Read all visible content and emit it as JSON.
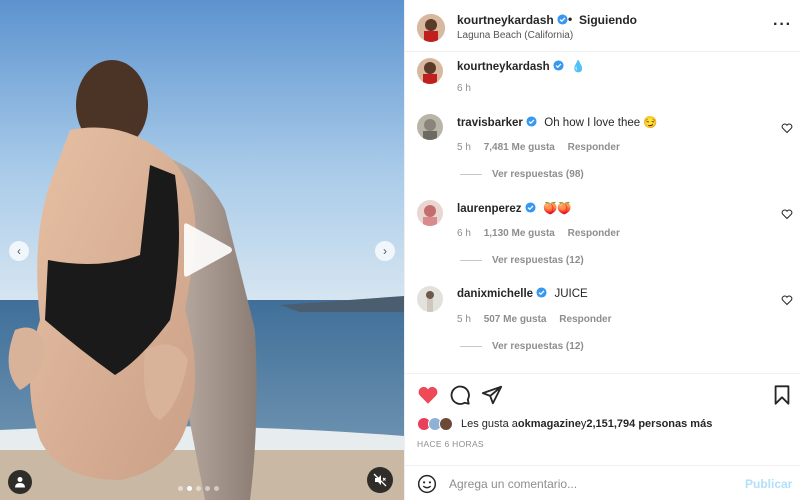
{
  "post": {
    "username": "kourtneykardash",
    "follow_status": "Siguiendo",
    "separator": "•",
    "location": "Laguna Beach (California)",
    "caption_emoji": "💧",
    "caption_time": "6 h"
  },
  "comments": [
    {
      "user": "travisbarker",
      "text": "Oh how I love thee 😏",
      "time": "5 h",
      "likes": "7,481 Me gusta",
      "reply": "Responder",
      "replies": "Ver respuestas (98)"
    },
    {
      "user": "laurenperez",
      "text": "🍑🍑",
      "time": "6 h",
      "likes": "1,130 Me gusta",
      "reply": "Responder",
      "replies": "Ver respuestas (12)"
    },
    {
      "user": "danixmichelle",
      "text": "JUICE",
      "time": "5 h",
      "likes": "507 Me gusta",
      "reply": "Responder",
      "replies": "Ver respuestas (12)"
    }
  ],
  "likes": {
    "prefix": "Les gusta a ",
    "user": "okmagazine",
    "middle": " y ",
    "count": "2,151,794 personas más"
  },
  "timestamp": "HACE 6 HORAS",
  "comment_box": {
    "placeholder": "Agrega un comentario...",
    "post_label": "Publicar"
  },
  "carousel": {
    "count": 5,
    "active_index": 1
  },
  "icons": {
    "verified": "verified-badge-icon",
    "heart_filled": "heart-filled-icon",
    "comment": "comment-icon",
    "share": "share-icon",
    "save": "bookmark-icon",
    "emoji": "emoji-icon",
    "more": "more-options-icon",
    "play": "play-icon",
    "mute": "mute-icon",
    "user_tag": "user-tag-icon"
  },
  "colors": {
    "accent_heart": "#ed4956",
    "verified_blue": "#3897f0",
    "post_button": "#b2dffc"
  }
}
